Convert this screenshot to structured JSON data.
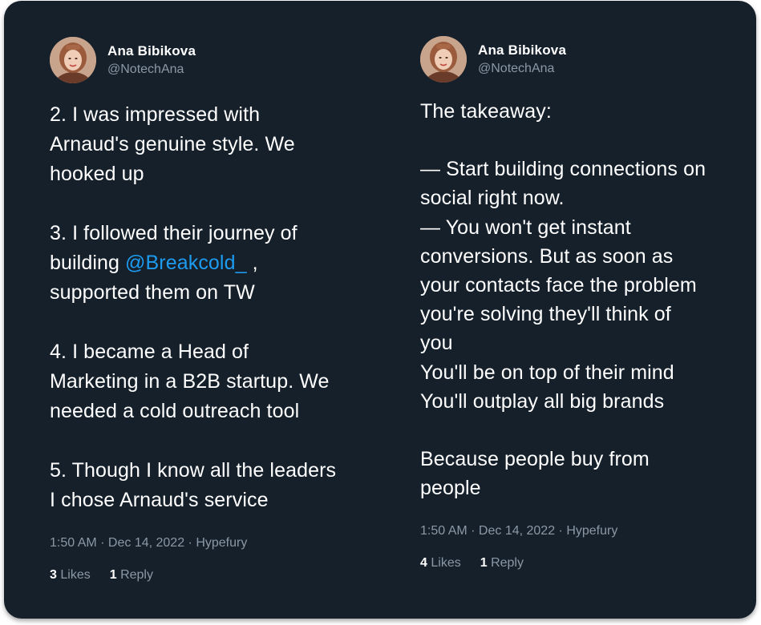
{
  "tweets": [
    {
      "author": {
        "name": "Ana Bibikova",
        "handle": "@NotechAna"
      },
      "paragraphs": [
        {
          "lines": [
            {
              "text": "2. I was impressed with"
            },
            {
              "text": "Arnaud's genuine style. We"
            },
            {
              "text": "hooked up"
            }
          ]
        },
        {
          "lines": [
            {
              "text": "3. I followed their journey of"
            },
            {
              "prefix": "building ",
              "mention": "@Breakcold_",
              "suffix": " ,"
            },
            {
              "text": "supported them on TW"
            }
          ]
        },
        {
          "lines": [
            {
              "text": "4. I became a Head of"
            },
            {
              "text": "Marketing in a B2B startup. We"
            },
            {
              "text": "needed a cold outreach tool"
            }
          ]
        },
        {
          "lines": [
            {
              "text": "5. Though I know all the leaders"
            },
            {
              "text": "I chose Arnaud's service"
            }
          ]
        }
      ],
      "meta": "1:50 AM · Dec 14, 2022 · Hypefury",
      "likes_count": "3",
      "likes_label": "Likes",
      "replies_count": "1",
      "replies_label": "Reply"
    },
    {
      "author": {
        "name": "Ana Bibikova",
        "handle": "@NotechAna"
      },
      "paragraphs": [
        {
          "lines": [
            {
              "text": "The takeaway:"
            }
          ]
        },
        {
          "lines": [
            {
              "text": "— Start building connections on"
            },
            {
              "text": "social right now."
            },
            {
              "text": "— You won't get instant"
            },
            {
              "text": "conversions. But as soon as"
            },
            {
              "text": "your contacts face the problem"
            },
            {
              "text": "you're solving they'll think of"
            },
            {
              "text": "you"
            },
            {
              "text": "You'll be on top of their mind"
            },
            {
              "text": "You'll outplay all big brands"
            }
          ]
        },
        {
          "lines": [
            {
              "text": "Because people buy from"
            },
            {
              "text": "people"
            }
          ]
        }
      ],
      "meta": "1:50 AM · Dec 14, 2022 · Hypefury",
      "likes_count": "4",
      "likes_label": "Likes",
      "replies_count": "1",
      "replies_label": "Reply"
    }
  ]
}
